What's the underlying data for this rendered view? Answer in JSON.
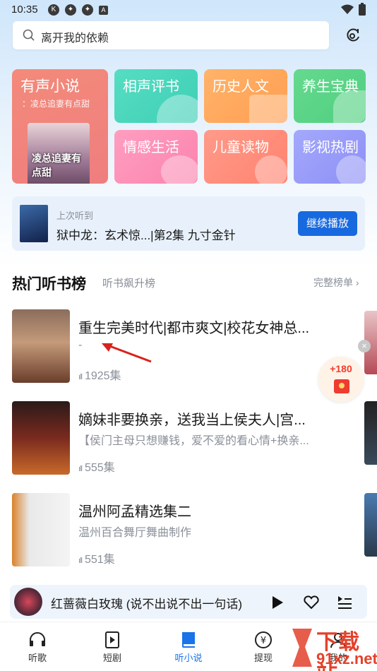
{
  "status": {
    "time": "10:35"
  },
  "search": {
    "placeholder": "离开我的依赖"
  },
  "categories": {
    "novel": {
      "label": "有声小说",
      "sub": "：凌总追妻有点甜",
      "cover_text": "凌总追妻有点甜"
    },
    "items": [
      {
        "label": "相声评书"
      },
      {
        "label": "历史人文"
      },
      {
        "label": "养生宝典"
      },
      {
        "label": "情感生活"
      },
      {
        "label": "儿童读物"
      },
      {
        "label": "影视热剧"
      }
    ]
  },
  "recent": {
    "label": "上次听到",
    "title": "狱中龙：玄术惊...|第2集 九寸金针",
    "button": "继续播放"
  },
  "section": {
    "title": "热门听书榜",
    "subtitle": "听书飙升榜",
    "more": "完整榜单"
  },
  "list": [
    {
      "title": "重生完美时代|都市爽文|校花女神总...",
      "desc": "-",
      "count": "1925集"
    },
    {
      "title": "嫡妹非要换亲，送我当上侯夫人|宫...",
      "desc": "【侯门主母只想赚钱，爱不爱的看心情+换亲...",
      "count": "555集"
    },
    {
      "title": "温州阿孟精选集二",
      "desc": "温州百合舞厅舞曲制作",
      "count": "551集"
    }
  ],
  "reward": {
    "amount": "+180"
  },
  "player": {
    "title": "红蔷薇白玫瑰 (说不出说不出一句话)"
  },
  "tabs": [
    {
      "label": "听歌"
    },
    {
      "label": "短剧"
    },
    {
      "label": "听小说"
    },
    {
      "label": "提现"
    },
    {
      "label": "我的"
    }
  ],
  "watermark": {
    "big": "下载站",
    "small": "91xz.net"
  },
  "colors": {
    "accent": "#1769e0",
    "active_tab": "#1a73e8",
    "reward": "#f23d2d"
  }
}
